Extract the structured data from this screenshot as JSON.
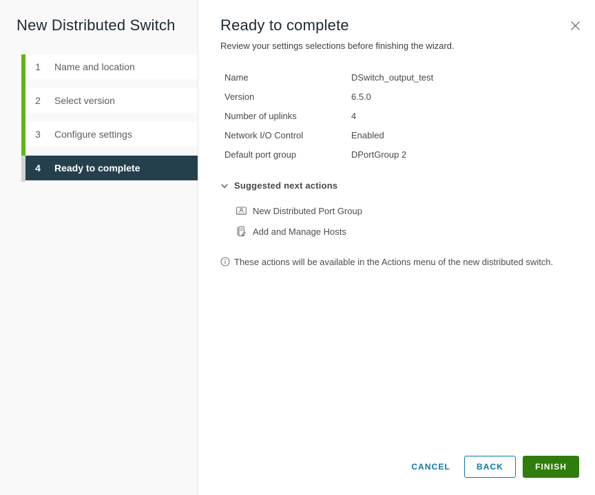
{
  "wizard": {
    "title": "New Distributed Switch",
    "steps": [
      {
        "number": "1",
        "label": "Name and location"
      },
      {
        "number": "2",
        "label": "Select version"
      },
      {
        "number": "3",
        "label": "Configure settings"
      },
      {
        "number": "4",
        "label": "Ready to complete"
      }
    ],
    "active_step": "4"
  },
  "panel": {
    "title": "Ready to complete",
    "subtitle": "Review your settings selections before finishing the wizard.",
    "summary": [
      {
        "label": "Name",
        "value": "DSwitch_output_test"
      },
      {
        "label": "Version",
        "value": "6.5.0"
      },
      {
        "label": "Number of uplinks",
        "value": "4"
      },
      {
        "label": "Network I/O Control",
        "value": "Enabled"
      },
      {
        "label": "Default port group",
        "value": "DPortGroup 2"
      }
    ],
    "suggested": {
      "header": "Suggested next actions",
      "expanded": true,
      "actions": [
        {
          "label": "New Distributed Port Group",
          "icon": "port-group-icon"
        },
        {
          "label": "Add and Manage Hosts",
          "icon": "hosts-edit-icon"
        }
      ]
    },
    "note": "These actions will be available in the Actions menu of the new distributed switch."
  },
  "footer": {
    "cancel_label": "CANCEL",
    "back_label": "BACK",
    "finish_label": "FINISH"
  },
  "icons": {
    "close": "x",
    "section_chevron": "chevron-down",
    "note": "info-circle"
  },
  "colors": {
    "accent_green": "#60b515",
    "active_step_bg": "#25404d",
    "primary_blue": "#0079b8",
    "finish_green": "#2f7d0a",
    "sidebar_bg": "#f9f9f9"
  }
}
